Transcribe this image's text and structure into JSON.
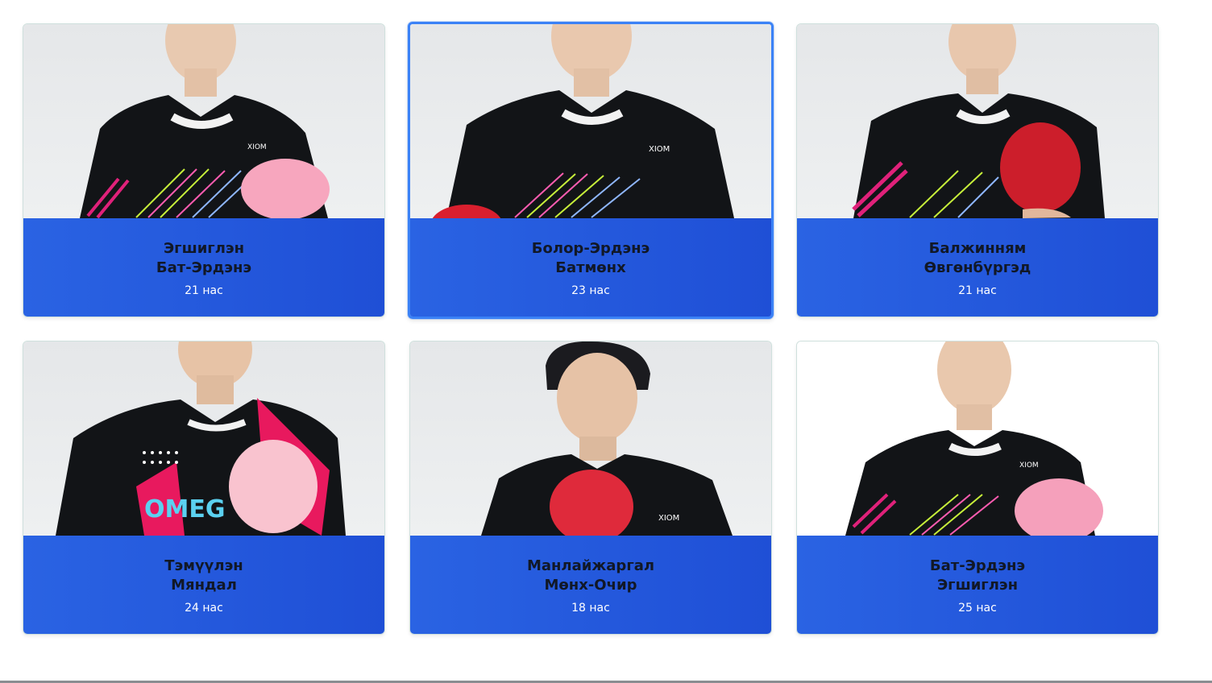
{
  "players": [
    {
      "first": "Эгшиглэн",
      "last": "Бат-Эрдэнэ",
      "age": "21 нас",
      "paddle_color": "#f7a6be",
      "jersey_accent": "#e0217a"
    },
    {
      "first": "Болор-Эрдэнэ",
      "last": "Батмөнх",
      "age": "23 нас",
      "paddle_color": "#d91f2e",
      "jersey_accent": "#e0217a",
      "selected": true
    },
    {
      "first": "Балжинням",
      "last": "Өвгөнбүргэд",
      "age": "21 нас",
      "paddle_color": "#cc1e2b",
      "jersey_accent": "#e0217a"
    },
    {
      "first": "Тэмүүлэн",
      "last": "Мяндал",
      "age": "24 нас",
      "paddle_color": "#f9c3cf",
      "jersey_accent": "#e8195e"
    },
    {
      "first": "Манлайжаргал",
      "last": "Мөнх-Очир",
      "age": "18 нас",
      "paddle_color": "#df2a3b",
      "jersey_accent": "#e0217a"
    },
    {
      "first": "Бат-Эрдэнэ",
      "last": "Эгшиглэн",
      "age": "25 нас",
      "paddle_color": "#f5a0bb",
      "jersey_accent": "#e0217a"
    }
  ],
  "colors": {
    "card_info_bg": "#2a63e3",
    "selected_border": "#3b82f6",
    "name_text": "#111827",
    "age_text": "#ffffff"
  },
  "icons": [
    "player-photo",
    "table-tennis-paddle"
  ]
}
